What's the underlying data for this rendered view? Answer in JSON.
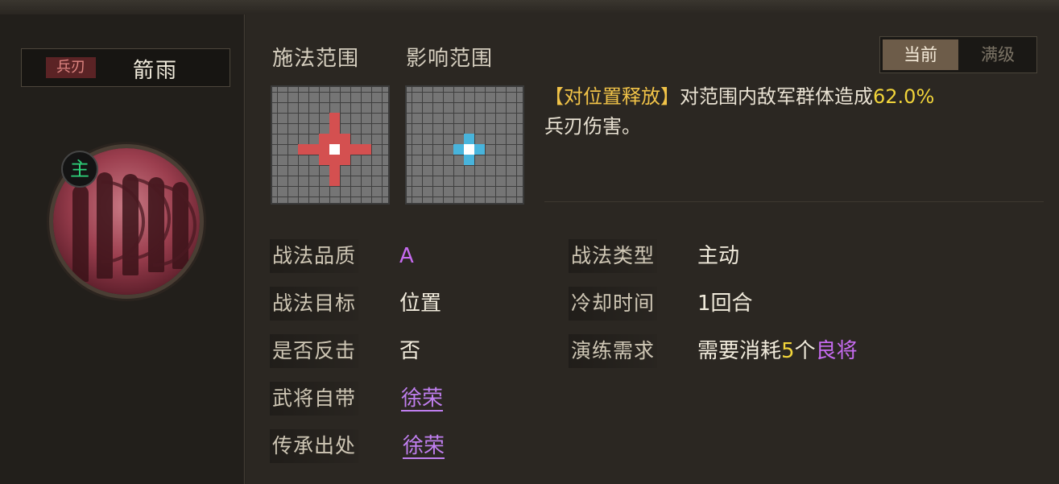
{
  "skill": {
    "type_tag": "兵刃",
    "name": "箭雨",
    "role_badge": "主"
  },
  "range": {
    "cast_label": "施法范围",
    "effect_label": "影响范围"
  },
  "level_toggle": {
    "current": "当前",
    "max": "满级"
  },
  "description": {
    "bracket_text": "【对位置释放】",
    "text_1": "对范围内敌军群体造成",
    "percent": "62.0%",
    "text_2": "兵刃伤害。"
  },
  "properties": {
    "quality": {
      "label": "战法品质",
      "value": "A"
    },
    "target": {
      "label": "战法目标",
      "value": "位置"
    },
    "counter": {
      "label": "是否反击",
      "value": "否"
    },
    "general_owned": {
      "label": "武将自带",
      "value": "徐荣"
    },
    "inherit_source": {
      "label": "传承出处",
      "value": "徐荣"
    },
    "skill_type": {
      "label": "战法类型",
      "value": "主动"
    },
    "cooldown": {
      "label": "冷却时间",
      "value": "1回合"
    },
    "drill": {
      "label": "演练需求",
      "prefix": "需要消耗",
      "count": "5",
      "unit": "个",
      "item": "良将"
    }
  },
  "colors": {
    "cast_cell": "#d45050",
    "effect_cell": "#48b4dc",
    "center_cell": "#ffffff",
    "purple": "#c66bf0",
    "gold": "#f1c348"
  },
  "icons": {
    "badge": "main-badge-icon",
    "portrait": "archer-portrait-icon"
  }
}
